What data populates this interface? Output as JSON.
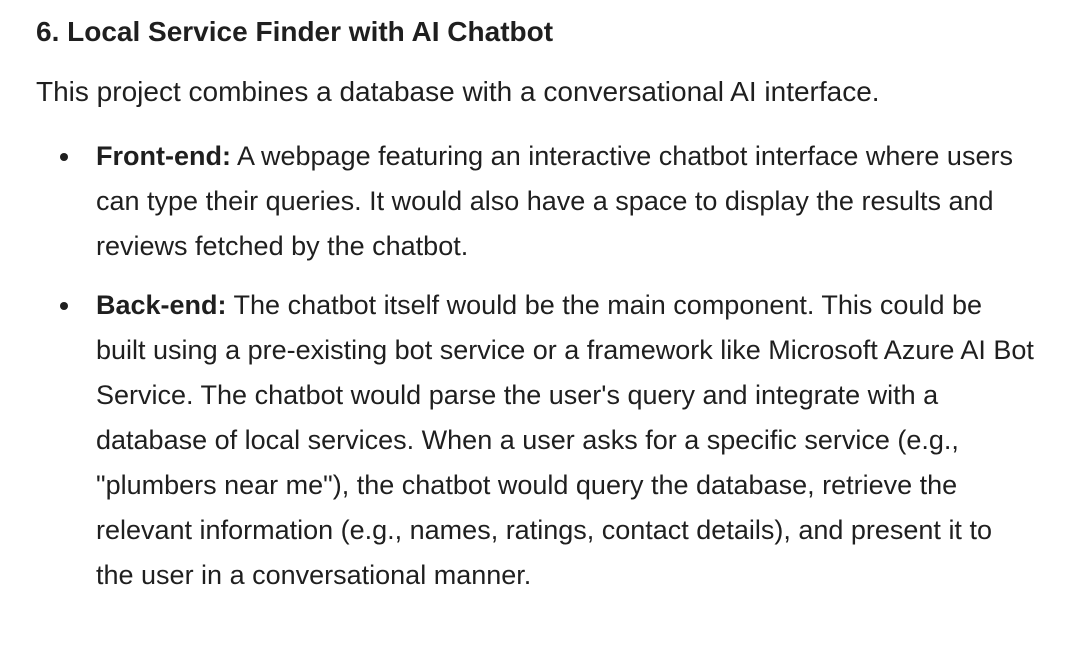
{
  "document": {
    "title": "6. Local Service Finder with AI Chatbot",
    "intro": "This project combines a database with a conversational AI interface.",
    "bullets": [
      {
        "term": "Front-end:",
        "text": " A webpage featuring an interactive chatbot interface where users can type their queries. It would also have a space to display the results and reviews fetched by the chatbot."
      },
      {
        "term": "Back-end:",
        "text": " The chatbot itself would be the main component. This could be built using a pre-existing bot service or a framework like Microsoft Azure AI Bot Service. The chatbot would parse the user's query and integrate with a database of local services. When a user asks for a specific service (e.g., \"plumbers near me\"), the chatbot would query the database, retrieve the relevant information (e.g., names, ratings, contact details), and present it to the user in a conversational manner."
      }
    ]
  }
}
